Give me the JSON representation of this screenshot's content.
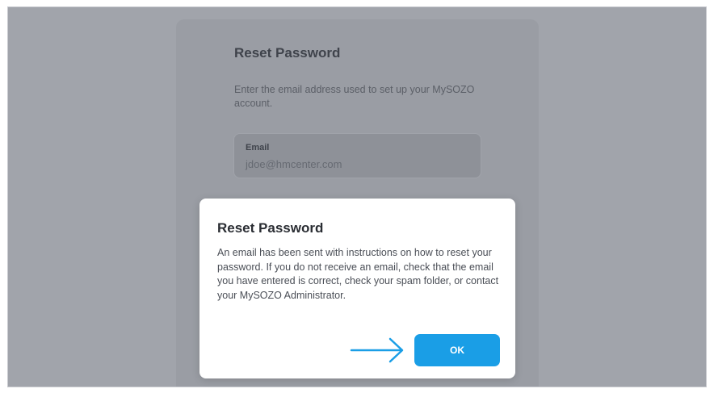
{
  "background_card": {
    "title": "Reset Password",
    "description": "Enter the email address used to set up your MySOZO account.",
    "email_field": {
      "label": "Email",
      "value": "jdoe@hmcenter.com"
    }
  },
  "dialog": {
    "title": "Reset Password",
    "message": "An email has been sent with instructions on how to reset your password. If you do not receive an email, check that the email you have entered is correct, check your spam folder, or contact your MySOZO Administrator.",
    "ok_label": "OK"
  },
  "annotation": {
    "icon": "arrow-right-icon",
    "color": "#1a9ee6"
  },
  "colors": {
    "accent": "#1a9ee6",
    "overlay": "#a1a4ab"
  }
}
